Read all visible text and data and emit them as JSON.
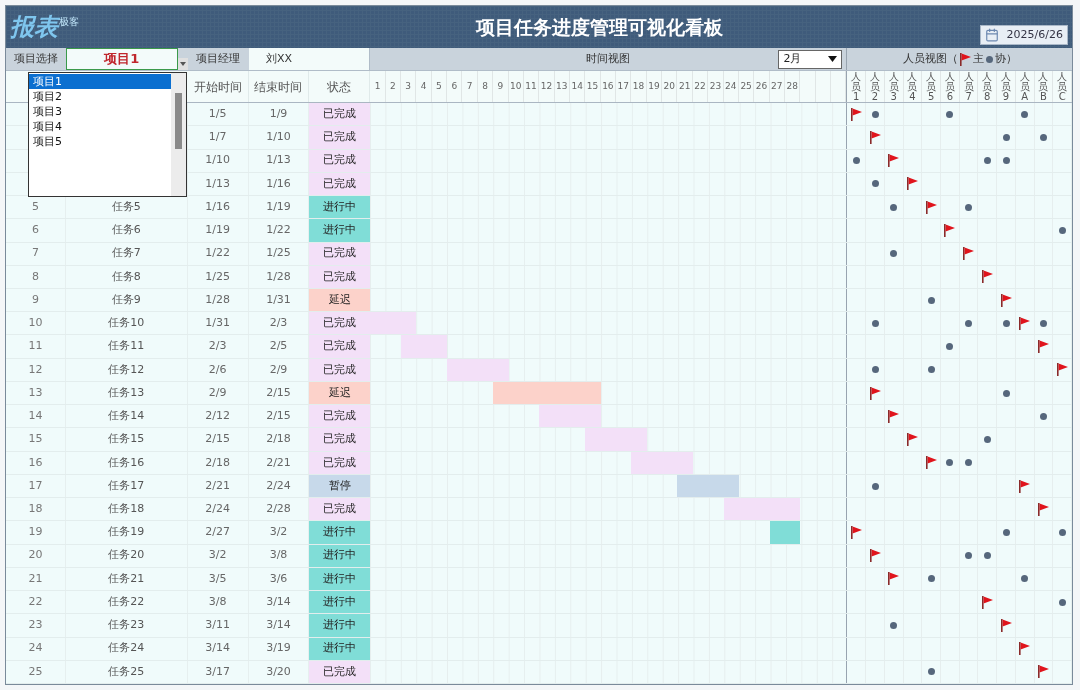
{
  "header": {
    "logo": "报表",
    "logo_sub": "极客",
    "title": "项目任务进度管理可视化看板",
    "date": "2025/6/26"
  },
  "project_bar": {
    "project_label": "项目选择",
    "project_value": "项目1",
    "manager_label": "项目经理",
    "manager_value": "刘XX",
    "time_view_label": "时间视图",
    "month": "2月",
    "people_view_label": "人员视图（",
    "legend_lead": "主",
    "legend_help": "协）"
  },
  "columns": [
    "开始时间",
    "结束时间",
    "状态"
  ],
  "days": [
    "1",
    "2",
    "3",
    "4",
    "5",
    "6",
    "7",
    "8",
    "9",
    "10",
    "11",
    "12",
    "13",
    "14",
    "15",
    "16",
    "17",
    "18",
    "19",
    "20",
    "21",
    "22",
    "23",
    "24",
    "25",
    "26",
    "27",
    "28"
  ],
  "people": [
    "人员1",
    "人员2",
    "人员3",
    "人员4",
    "人员5",
    "人员6",
    "人员7",
    "人员8",
    "人员9",
    "人员A",
    "人员B",
    "人员C"
  ],
  "tasks": [
    {
      "start": "1/5",
      "end": "1/9",
      "status": "已完成",
      "kind": "done",
      "team": [
        {
          "kind": "lead"
        },
        {
          "kind": "help"
        },
        {
          "kind": "none"
        },
        {
          "kind": "none"
        },
        {
          "kind": "none"
        },
        {
          "kind": "help"
        },
        {
          "kind": "none"
        },
        {
          "kind": "none"
        },
        {
          "kind": "none"
        },
        {
          "kind": "help"
        },
        {
          "kind": "none"
        },
        {
          "kind": "none"
        }
      ]
    },
    {
      "start": "1/7",
      "end": "1/10",
      "status": "已完成",
      "kind": "done",
      "team": [
        {
          "kind": "none"
        },
        {
          "kind": "lead"
        },
        {
          "kind": "none"
        },
        {
          "kind": "none"
        },
        {
          "kind": "none"
        },
        {
          "kind": "none"
        },
        {
          "kind": "none"
        },
        {
          "kind": "none"
        },
        {
          "kind": "help"
        },
        {
          "kind": "none"
        },
        {
          "kind": "help"
        },
        {
          "kind": "none"
        }
      ]
    },
    {
      "start": "1/10",
      "end": "1/13",
      "status": "已完成",
      "kind": "done",
      "team": [
        {
          "kind": "help"
        },
        {
          "kind": "none"
        },
        {
          "kind": "lead"
        },
        {
          "kind": "none"
        },
        {
          "kind": "none"
        },
        {
          "kind": "none"
        },
        {
          "kind": "none"
        },
        {
          "kind": "help"
        },
        {
          "kind": "help"
        },
        {
          "kind": "none"
        },
        {
          "kind": "none"
        },
        {
          "kind": "none"
        }
      ]
    },
    {
      "start": "1/13",
      "end": "1/16",
      "status": "已完成",
      "kind": "done",
      "team": [
        {
          "kind": "none"
        },
        {
          "kind": "help"
        },
        {
          "kind": "none"
        },
        {
          "kind": "lead"
        },
        {
          "kind": "none"
        },
        {
          "kind": "none"
        },
        {
          "kind": "none"
        },
        {
          "kind": "none"
        },
        {
          "kind": "none"
        },
        {
          "kind": "none"
        },
        {
          "kind": "none"
        },
        {
          "kind": "none"
        }
      ]
    },
    {
      "no": "5",
      "name": "任务5",
      "start": "1/16",
      "end": "1/19",
      "status": "进行中",
      "kind": "active",
      "team": [
        {
          "kind": "none"
        },
        {
          "kind": "none"
        },
        {
          "kind": "help"
        },
        {
          "kind": "none"
        },
        {
          "kind": "lead"
        },
        {
          "kind": "none"
        },
        {
          "kind": "help"
        },
        {
          "kind": "none"
        },
        {
          "kind": "none"
        },
        {
          "kind": "none"
        },
        {
          "kind": "none"
        },
        {
          "kind": "none"
        }
      ]
    },
    {
      "no": "6",
      "name": "任务6",
      "start": "1/19",
      "end": "1/22",
      "status": "进行中",
      "kind": "active",
      "team": [
        {
          "kind": "none"
        },
        {
          "kind": "none"
        },
        {
          "kind": "none"
        },
        {
          "kind": "none"
        },
        {
          "kind": "none"
        },
        {
          "kind": "lead"
        },
        {
          "kind": "none"
        },
        {
          "kind": "none"
        },
        {
          "kind": "none"
        },
        {
          "kind": "none"
        },
        {
          "kind": "none"
        },
        {
          "kind": "help"
        }
      ]
    },
    {
      "no": "7",
      "name": "任务7",
      "start": "1/22",
      "end": "1/25",
      "status": "已完成",
      "kind": "done",
      "team": [
        {
          "kind": "none"
        },
        {
          "kind": "none"
        },
        {
          "kind": "help"
        },
        {
          "kind": "none"
        },
        {
          "kind": "none"
        },
        {
          "kind": "none"
        },
        {
          "kind": "lead"
        },
        {
          "kind": "none"
        },
        {
          "kind": "none"
        },
        {
          "kind": "none"
        },
        {
          "kind": "none"
        },
        {
          "kind": "none"
        }
      ]
    },
    {
      "no": "8",
      "name": "任务8",
      "start": "1/25",
      "end": "1/28",
      "status": "已完成",
      "kind": "done",
      "team": [
        {
          "kind": "none"
        },
        {
          "kind": "none"
        },
        {
          "kind": "none"
        },
        {
          "kind": "none"
        },
        {
          "kind": "none"
        },
        {
          "kind": "none"
        },
        {
          "kind": "none"
        },
        {
          "kind": "lead"
        },
        {
          "kind": "none"
        },
        {
          "kind": "none"
        },
        {
          "kind": "none"
        },
        {
          "kind": "none"
        }
      ]
    },
    {
      "no": "9",
      "name": "任务9",
      "start": "1/28",
      "end": "1/31",
      "status": "延迟",
      "kind": "delayed",
      "team": [
        {
          "kind": "none"
        },
        {
          "kind": "none"
        },
        {
          "kind": "none"
        },
        {
          "kind": "none"
        },
        {
          "kind": "help"
        },
        {
          "kind": "none"
        },
        {
          "kind": "none"
        },
        {
          "kind": "none"
        },
        {
          "kind": "lead"
        },
        {
          "kind": "none"
        },
        {
          "kind": "none"
        },
        {
          "kind": "none"
        }
      ]
    },
    {
      "no": "10",
      "name": "任务10",
      "start": "1/31",
      "end": "2/3",
      "status": "已完成",
      "kind": "done",
      "team": [
        {
          "kind": "none"
        },
        {
          "kind": "help"
        },
        {
          "kind": "none"
        },
        {
          "kind": "none"
        },
        {
          "kind": "none"
        },
        {
          "kind": "none"
        },
        {
          "kind": "help"
        },
        {
          "kind": "none"
        },
        {
          "kind": "help"
        },
        {
          "kind": "lead"
        },
        {
          "kind": "help"
        },
        {
          "kind": "none"
        }
      ]
    },
    {
      "no": "11",
      "name": "任务11",
      "start": "2/3",
      "end": "2/5",
      "status": "已完成",
      "kind": "done",
      "team": [
        {
          "kind": "none"
        },
        {
          "kind": "none"
        },
        {
          "kind": "none"
        },
        {
          "kind": "none"
        },
        {
          "kind": "none"
        },
        {
          "kind": "help"
        },
        {
          "kind": "none"
        },
        {
          "kind": "none"
        },
        {
          "kind": "none"
        },
        {
          "kind": "none"
        },
        {
          "kind": "lead"
        },
        {
          "kind": "none"
        }
      ]
    },
    {
      "no": "12",
      "name": "任务12",
      "start": "2/6",
      "end": "2/9",
      "status": "已完成",
      "kind": "done",
      "team": [
        {
          "kind": "none"
        },
        {
          "kind": "help"
        },
        {
          "kind": "none"
        },
        {
          "kind": "none"
        },
        {
          "kind": "help"
        },
        {
          "kind": "none"
        },
        {
          "kind": "none"
        },
        {
          "kind": "none"
        },
        {
          "kind": "none"
        },
        {
          "kind": "none"
        },
        {
          "kind": "none"
        },
        {
          "kind": "lead"
        }
      ]
    },
    {
      "no": "13",
      "name": "任务13",
      "start": "2/9",
      "end": "2/15",
      "status": "延迟",
      "kind": "delayed",
      "team": [
        {
          "kind": "none"
        },
        {
          "kind": "lead"
        },
        {
          "kind": "none"
        },
        {
          "kind": "none"
        },
        {
          "kind": "none"
        },
        {
          "kind": "none"
        },
        {
          "kind": "none"
        },
        {
          "kind": "none"
        },
        {
          "kind": "help"
        },
        {
          "kind": "none"
        },
        {
          "kind": "none"
        },
        {
          "kind": "none"
        }
      ]
    },
    {
      "no": "14",
      "name": "任务14",
      "start": "2/12",
      "end": "2/15",
      "status": "已完成",
      "kind": "done",
      "team": [
        {
          "kind": "none"
        },
        {
          "kind": "none"
        },
        {
          "kind": "lead"
        },
        {
          "kind": "none"
        },
        {
          "kind": "none"
        },
        {
          "kind": "none"
        },
        {
          "kind": "none"
        },
        {
          "kind": "none"
        },
        {
          "kind": "none"
        },
        {
          "kind": "none"
        },
        {
          "kind": "help"
        },
        {
          "kind": "none"
        }
      ]
    },
    {
      "no": "15",
      "name": "任务15",
      "start": "2/15",
      "end": "2/18",
      "status": "已完成",
      "kind": "done",
      "team": [
        {
          "kind": "none"
        },
        {
          "kind": "none"
        },
        {
          "kind": "none"
        },
        {
          "kind": "lead"
        },
        {
          "kind": "none"
        },
        {
          "kind": "none"
        },
        {
          "kind": "none"
        },
        {
          "kind": "help"
        },
        {
          "kind": "none"
        },
        {
          "kind": "none"
        },
        {
          "kind": "none"
        },
        {
          "kind": "none"
        }
      ]
    },
    {
      "no": "16",
      "name": "任务16",
      "start": "2/18",
      "end": "2/21",
      "status": "已完成",
      "kind": "done",
      "team": [
        {
          "kind": "none"
        },
        {
          "kind": "none"
        },
        {
          "kind": "none"
        },
        {
          "kind": "none"
        },
        {
          "kind": "lead"
        },
        {
          "kind": "help"
        },
        {
          "kind": "help"
        },
        {
          "kind": "none"
        },
        {
          "kind": "none"
        },
        {
          "kind": "none"
        },
        {
          "kind": "none"
        },
        {
          "kind": "none"
        }
      ]
    },
    {
      "no": "17",
      "name": "任务17",
      "start": "2/21",
      "end": "2/24",
      "status": "暂停",
      "kind": "paused",
      "team": [
        {
          "kind": "none"
        },
        {
          "kind": "help"
        },
        {
          "kind": "none"
        },
        {
          "kind": "none"
        },
        {
          "kind": "none"
        },
        {
          "kind": "none"
        },
        {
          "kind": "none"
        },
        {
          "kind": "none"
        },
        {
          "kind": "none"
        },
        {
          "kind": "lead"
        },
        {
          "kind": "none"
        },
        {
          "kind": "none"
        }
      ]
    },
    {
      "no": "18",
      "name": "任务18",
      "start": "2/24",
      "end": "2/28",
      "status": "已完成",
      "kind": "done",
      "team": [
        {
          "kind": "none"
        },
        {
          "kind": "none"
        },
        {
          "kind": "none"
        },
        {
          "kind": "none"
        },
        {
          "kind": "none"
        },
        {
          "kind": "none"
        },
        {
          "kind": "none"
        },
        {
          "kind": "none"
        },
        {
          "kind": "none"
        },
        {
          "kind": "none"
        },
        {
          "kind": "lead"
        },
        {
          "kind": "none"
        }
      ]
    },
    {
      "no": "19",
      "name": "任务19",
      "start": "2/27",
      "end": "3/2",
      "status": "进行中",
      "kind": "active",
      "team": [
        {
          "kind": "lead"
        },
        {
          "kind": "none"
        },
        {
          "kind": "none"
        },
        {
          "kind": "none"
        },
        {
          "kind": "none"
        },
        {
          "kind": "none"
        },
        {
          "kind": "none"
        },
        {
          "kind": "none"
        },
        {
          "kind": "help"
        },
        {
          "kind": "none"
        },
        {
          "kind": "none"
        },
        {
          "kind": "help"
        }
      ]
    },
    {
      "no": "20",
      "name": "任务20",
      "start": "3/2",
      "end": "3/8",
      "status": "进行中",
      "kind": "active",
      "team": [
        {
          "kind": "none"
        },
        {
          "kind": "lead"
        },
        {
          "kind": "none"
        },
        {
          "kind": "none"
        },
        {
          "kind": "none"
        },
        {
          "kind": "none"
        },
        {
          "kind": "help"
        },
        {
          "kind": "help"
        },
        {
          "kind": "none"
        },
        {
          "kind": "none"
        },
        {
          "kind": "none"
        },
        {
          "kind": "none"
        }
      ]
    },
    {
      "no": "21",
      "name": "任务21",
      "start": "3/5",
      "end": "3/6",
      "status": "进行中",
      "kind": "active",
      "team": [
        {
          "kind": "none"
        },
        {
          "kind": "none"
        },
        {
          "kind": "lead"
        },
        {
          "kind": "none"
        },
        {
          "kind": "help"
        },
        {
          "kind": "none"
        },
        {
          "kind": "none"
        },
        {
          "kind": "none"
        },
        {
          "kind": "none"
        },
        {
          "kind": "help"
        },
        {
          "kind": "none"
        },
        {
          "kind": "none"
        }
      ]
    },
    {
      "no": "22",
      "name": "任务22",
      "start": "3/8",
      "end": "3/14",
      "status": "进行中",
      "kind": "active",
      "team": [
        {
          "kind": "none"
        },
        {
          "kind": "none"
        },
        {
          "kind": "none"
        },
        {
          "kind": "none"
        },
        {
          "kind": "none"
        },
        {
          "kind": "none"
        },
        {
          "kind": "none"
        },
        {
          "kind": "lead"
        },
        {
          "kind": "none"
        },
        {
          "kind": "none"
        },
        {
          "kind": "none"
        },
        {
          "kind": "help"
        }
      ]
    },
    {
      "no": "23",
      "name": "任务23",
      "start": "3/11",
      "end": "3/14",
      "status": "进行中",
      "kind": "active",
      "team": [
        {
          "kind": "none"
        },
        {
          "kind": "none"
        },
        {
          "kind": "help"
        },
        {
          "kind": "none"
        },
        {
          "kind": "none"
        },
        {
          "kind": "none"
        },
        {
          "kind": "none"
        },
        {
          "kind": "none"
        },
        {
          "kind": "lead"
        },
        {
          "kind": "none"
        },
        {
          "kind": "none"
        },
        {
          "kind": "none"
        }
      ]
    },
    {
      "no": "24",
      "name": "任务24",
      "start": "3/14",
      "end": "3/19",
      "status": "进行中",
      "kind": "active",
      "team": [
        {
          "kind": "none"
        },
        {
          "kind": "none"
        },
        {
          "kind": "none"
        },
        {
          "kind": "none"
        },
        {
          "kind": "none"
        },
        {
          "kind": "none"
        },
        {
          "kind": "none"
        },
        {
          "kind": "none"
        },
        {
          "kind": "none"
        },
        {
          "kind": "lead"
        },
        {
          "kind": "none"
        },
        {
          "kind": "none"
        }
      ]
    },
    {
      "no": "25",
      "name": "任务25",
      "start": "3/17",
      "end": "3/20",
      "status": "已完成",
      "kind": "done",
      "team": [
        {
          "kind": "none"
        },
        {
          "kind": "none"
        },
        {
          "kind": "none"
        },
        {
          "kind": "none"
        },
        {
          "kind": "help"
        },
        {
          "kind": "none"
        },
        {
          "kind": "none"
        },
        {
          "kind": "none"
        },
        {
          "kind": "none"
        },
        {
          "kind": "none"
        },
        {
          "kind": "lead"
        },
        {
          "kind": "none"
        }
      ]
    }
  ],
  "dropdown": {
    "items": [
      {
        "label": "项目1",
        "selected": true
      },
      {
        "label": "项目2",
        "selected": false
      },
      {
        "label": "项目3",
        "selected": false
      },
      {
        "label": "项目4",
        "selected": false
      },
      {
        "label": "项目5",
        "selected": false
      }
    ]
  }
}
